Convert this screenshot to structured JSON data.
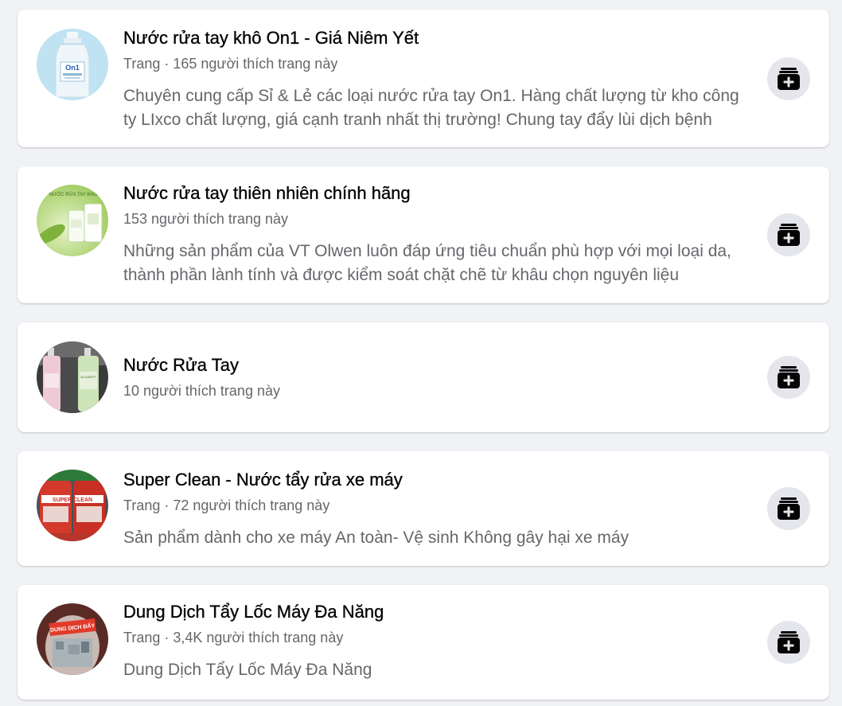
{
  "results": [
    {
      "title": "Nước rửa tay khô On1 - Giá Niêm Yết",
      "meta": "Trang · 165 người thích trang này",
      "description": "Chuyên cung cấp Sỉ & Lẻ các loại nước rửa tay On1. Hàng chất lượng từ kho công ty LIxco chất lượng, giá cạnh tranh nhất thị trường! Chung tay đẩy lùi dịch bệnh",
      "avatar_text": "On1"
    },
    {
      "title": "Nước rửa tay thiên nhiên chính hãng",
      "meta": "153 người thích trang này",
      "description": "Những sản phẩm của VT Olwen luôn đáp ứng tiêu chuẩn phù hợp với mọi loại da, thành phần lành tính và được kiểm soát chặt chẽ từ khâu chọn nguyên liệu",
      "avatar_text": "NƯỚC RỬA TAY KHÔ"
    },
    {
      "title": "Nước Rửa Tay",
      "meta": "10 người thích trang này",
      "description": "",
      "avatar_text": "ALTASEPT"
    },
    {
      "title": "Super Clean - Nước tẩy rửa xe máy",
      "meta": "Trang · 72 người thích trang này",
      "description": "Sản phẩm dành cho xe máy An toàn- Vệ sinh Không gây hại xe máy",
      "avatar_text": "SUPER CLEAN"
    },
    {
      "title": "Dung Dịch Tẩy Lốc Máy Đa Năng",
      "meta": "Trang · 3,4K người thích trang này",
      "description": "Dung Dịch Tẩy Lốc Máy Đa Năng",
      "avatar_text": "DUNG DỊCH ĐẨY"
    }
  ],
  "action_icon": "like-page-plus-icon",
  "colors": {
    "page_bg": "#f0f2f5",
    "card_bg": "#ffffff",
    "title": "#050505",
    "secondary_text": "#65676b",
    "button_bg": "#e4e6eb"
  }
}
